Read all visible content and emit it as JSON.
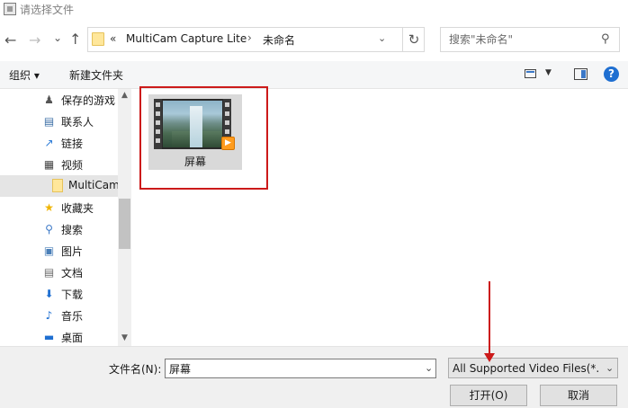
{
  "window": {
    "title": "请选择文件"
  },
  "nav": {
    "back": "←",
    "forward": "→",
    "recent": "⌄",
    "up": "↑"
  },
  "address": {
    "prefix": "«",
    "crumbs": [
      "MultiCam Capture Lite",
      "未命名"
    ],
    "separator": "›",
    "dropdown": "⌄",
    "refresh": "↻"
  },
  "search": {
    "placeholder": "搜索\"未命名\"",
    "icon": "⚲"
  },
  "toolbar": {
    "organize_label": "组织 ▾",
    "new_folder_label": "新建文件夹",
    "view_dropdown": "▼",
    "help": "?"
  },
  "sidebar": {
    "items": [
      {
        "label": "保存的游戏",
        "icon": "saved-games-icon",
        "glyph": "♟",
        "color": "#555555"
      },
      {
        "label": "联系人",
        "icon": "contacts-icon",
        "glyph": "▤",
        "color": "#3b6ea5"
      },
      {
        "label": "链接",
        "icon": "links-icon",
        "glyph": "↗",
        "color": "#2b7bd6"
      },
      {
        "label": "视频",
        "icon": "videos-icon",
        "glyph": "▦",
        "color": "#444444"
      },
      {
        "label": "MultiCam",
        "icon": "folder-icon",
        "glyph": "",
        "color": "#e6c25a",
        "selected": true
      },
      {
        "label": "收藏夹",
        "icon": "favorites-icon",
        "glyph": "★",
        "color": "#f0b400"
      },
      {
        "label": "搜索",
        "icon": "search-icon",
        "glyph": "⚲",
        "color": "#3b78c7"
      },
      {
        "label": "图片",
        "icon": "pictures-icon",
        "glyph": "▣",
        "color": "#4a7fb8"
      },
      {
        "label": "文档",
        "icon": "documents-icon",
        "glyph": "▤",
        "color": "#6a6a6a"
      },
      {
        "label": "下载",
        "icon": "downloads-icon",
        "glyph": "⬇",
        "color": "#1f6fd1"
      },
      {
        "label": "音乐",
        "icon": "music-icon",
        "glyph": "♪",
        "color": "#1f6fd1"
      },
      {
        "label": "桌面",
        "icon": "desktop-icon",
        "glyph": "▬",
        "color": "#1f6fd1"
      }
    ],
    "scroll_up": "▲",
    "scroll_down": "▼"
  },
  "files": [
    {
      "name": "屏幕",
      "type": "video",
      "badge": "▶"
    }
  ],
  "bottom": {
    "filename_label": "文件名(N):",
    "filename_value": "屏幕",
    "filename_dropdown": "⌄",
    "filetype_value": "All Supported Video Files(*.",
    "filetype_dropdown": "⌄",
    "open_label": "打开(O)",
    "cancel_label": "取消"
  },
  "annotation_color": "#cc1a1a"
}
